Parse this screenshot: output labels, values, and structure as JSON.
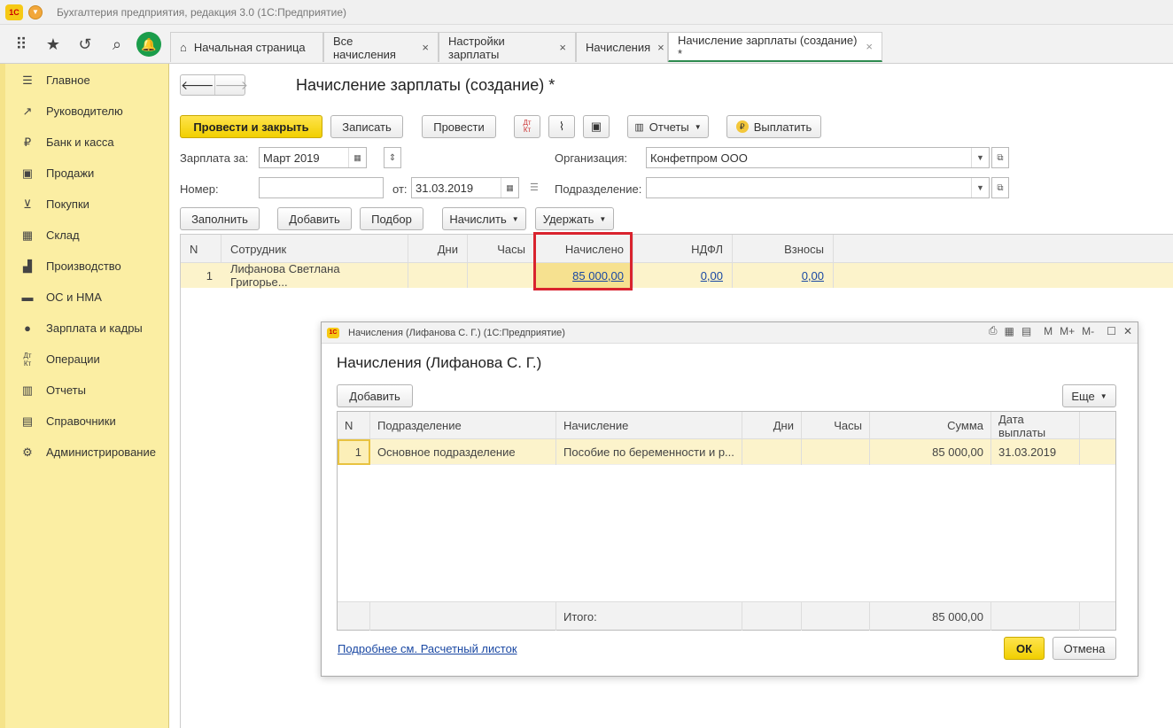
{
  "window": {
    "title": "Бухгалтерия предприятия, редакция 3.0  (1С:Предприятие)",
    "logo": "1С"
  },
  "tabs": [
    {
      "label": "Начальная страница",
      "closable": false
    },
    {
      "label": "Все начисления",
      "closable": true
    },
    {
      "label": "Настройки зарплаты",
      "closable": true
    },
    {
      "label": "Начисления",
      "closable": true
    },
    {
      "label": "Начисление зарплаты (создание) *",
      "closable": true
    }
  ],
  "tab_close_glyph": "×",
  "sidebar": {
    "items": [
      {
        "label": "Главное",
        "icon": "menu-lines-icon"
      },
      {
        "label": "Руководителю",
        "icon": "trend-icon"
      },
      {
        "label": "Банк и касса",
        "icon": "ruble-coin-icon"
      },
      {
        "label": "Продажи",
        "icon": "shopping-bag-icon"
      },
      {
        "label": "Покупки",
        "icon": "cart-icon"
      },
      {
        "label": "Склад",
        "icon": "warehouse-icon"
      },
      {
        "label": "Производство",
        "icon": "factory-icon"
      },
      {
        "label": "ОС и НМА",
        "icon": "truck-icon"
      },
      {
        "label": "Зарплата и кадры",
        "icon": "person-icon"
      },
      {
        "label": "Операции",
        "icon": "dt-kt-icon"
      },
      {
        "label": "Отчеты",
        "icon": "bar-chart-icon"
      },
      {
        "label": "Справочники",
        "icon": "books-icon"
      },
      {
        "label": "Администрирование",
        "icon": "gear-icon"
      }
    ]
  },
  "document": {
    "title": "Начисление зарплаты (создание) *",
    "buttons": {
      "post_close": "Провести и закрыть",
      "save": "Записать",
      "post": "Провести",
      "reports": "Отчеты",
      "pay": "Выплатить",
      "fill": "Заполнить",
      "add": "Добавить",
      "select": "Подбор",
      "accrue": "Начислить",
      "withhold": "Удержать"
    },
    "fields": {
      "salary_for_label": "Зарплата за:",
      "salary_for_value": "Март 2019",
      "number_label": "Номер:",
      "number_value": "",
      "date_label": "от:",
      "date_value": "31.03.2019",
      "org_label": "Организация:",
      "org_value": "Конфетпром ООО",
      "dept_label": "Подразделение:",
      "dept_value": ""
    },
    "table": {
      "headers": {
        "n": "N",
        "employee": "Сотрудник",
        "days": "Дни",
        "hours": "Часы",
        "accrued": "Начислено",
        "ndfl": "НДФЛ",
        "contrib": "Взносы"
      },
      "rows": [
        {
          "n": "1",
          "employee": "Лифанова Светлана Григорье...",
          "days": "",
          "hours": "",
          "accrued": "85 000,00",
          "ndfl": "0,00",
          "contrib": "0,00"
        }
      ]
    }
  },
  "modal": {
    "window_title": "Начисления (Лифанова С. Г.)  (1С:Предприятие)",
    "heading": "Начисления (Лифанова С. Г.)",
    "tools": {
      "m": "M",
      "m_plus": "M+",
      "m_minus": "M-"
    },
    "buttons": {
      "add": "Добавить",
      "more": "Еще",
      "ok": "ОК",
      "cancel": "Отмена"
    },
    "table": {
      "headers": {
        "n": "N",
        "dept": "Подразделение",
        "accrual": "Начисление",
        "days": "Дни",
        "hours": "Часы",
        "sum": "Сумма",
        "pay_date": "Дата выплаты"
      },
      "rows": [
        {
          "n": "1",
          "dept": "Основное подразделение",
          "accrual": "Пособие по беременности и р...",
          "days": "",
          "hours": "",
          "sum": "85 000,00",
          "pay_date": "31.03.2019"
        }
      ],
      "footer": {
        "label": "Итого:",
        "sum": "85 000,00"
      }
    },
    "link": "Подробнее см. Расчетный листок"
  }
}
